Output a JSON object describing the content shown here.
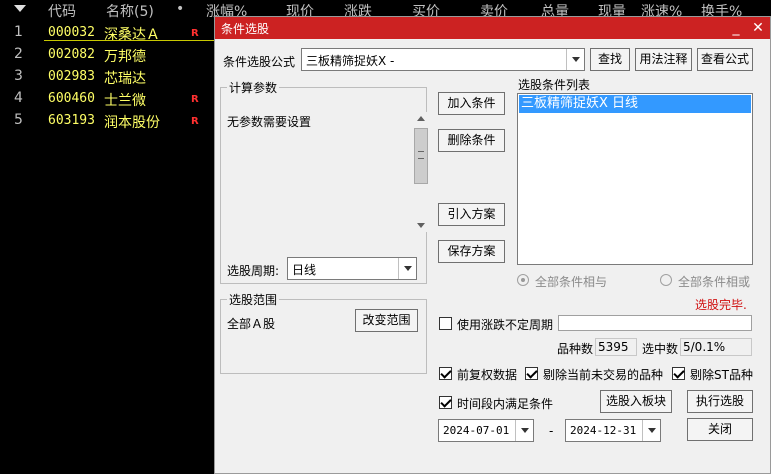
{
  "list_header": {
    "columns": [
      "代码",
      "名称(5)",
      "•",
      "涨幅%",
      "现价",
      "涨跌",
      "买价",
      "卖价",
      "总量",
      "现量",
      "涨速%",
      "换手%"
    ]
  },
  "stocks": [
    {
      "idx": "1",
      "code": "000032",
      "name": "深桑达Ａ",
      "flag": "R"
    },
    {
      "idx": "2",
      "code": "002082",
      "name": "万邦德",
      "flag": ""
    },
    {
      "idx": "3",
      "code": "002983",
      "name": "芯瑞达",
      "flag": ""
    },
    {
      "idx": "4",
      "code": "600460",
      "name": "士兰微",
      "flag": "R"
    },
    {
      "idx": "5",
      "code": "603193",
      "name": "润本股份",
      "flag": "R"
    }
  ],
  "dialog": {
    "title": "条件选股",
    "minimize": "_",
    "close": "✕",
    "formula_label": "条件选股公式",
    "formula_value": "三板精筛捉妖X -",
    "find_btn": "查找",
    "usage_btn": "用法注释",
    "view_formula_btn": "查看公式",
    "params_group": "计算参数",
    "params_text": "无参数需要设置",
    "period_label": "选股周期:",
    "period_value": "日线",
    "add_cond_btn": "加入条件",
    "del_cond_btn": "删除条件",
    "import_btn": "引入方案",
    "save_btn": "保存方案",
    "cond_list_label": "选股条件列表",
    "cond_items": [
      "三板精筛捉妖X  日线"
    ],
    "radio_all_and": "全部条件相与",
    "radio_all_or": "全部条件相或",
    "status": "选股完毕.",
    "range_group": "选股范围",
    "range_value": "全部Ａ股",
    "change_range_btn": "改变范围",
    "use_period_label": "使用涨跌不定周期",
    "count_label": "品种数",
    "count_value": "5395",
    "selected_label": "选中数",
    "selected_value": "5/0.1%",
    "fq_label": "前复权数据",
    "remove_untraded_label": "剔除当前未交易的品种",
    "remove_st_label": "剔除ST品种",
    "time_range_label": "时间段内满足条件",
    "to_block_btn": "选股入板块",
    "execute_btn": "执行选股",
    "date_from": "2024-07-01",
    "date_sep": "-",
    "date_to": "2024-12-31",
    "close_btn": "关闭"
  }
}
